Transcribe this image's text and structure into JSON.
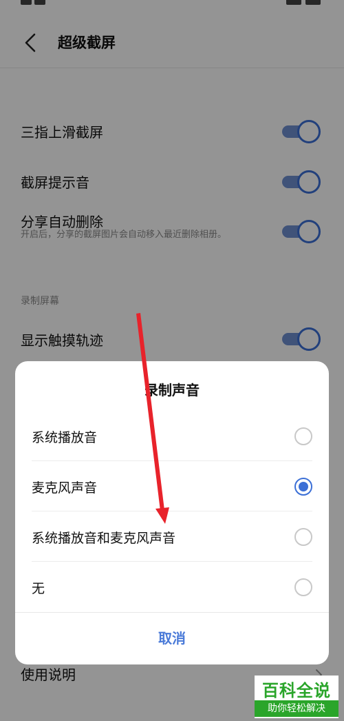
{
  "header": {
    "title": "超级截屏"
  },
  "settings": {
    "items": [
      {
        "label": "三指上滑截屏",
        "enabled": true
      },
      {
        "label": "截屏提示音",
        "enabled": true
      },
      {
        "label": "分享自动删除",
        "subtitle": "开启后，分享的截屏图片会自动移入最近删除相册。",
        "enabled": true
      }
    ],
    "section_record": "录制屏幕",
    "record_items": [
      {
        "label": "显示触摸轨迹",
        "enabled": true
      }
    ],
    "usage": "使用说明"
  },
  "dialog": {
    "title": "录制声音",
    "options": [
      {
        "label": "系统播放音",
        "selected": false
      },
      {
        "label": "麦克风声音",
        "selected": true
      },
      {
        "label": "系统播放音和麦克风声音",
        "selected": false
      },
      {
        "label": "无",
        "selected": false
      }
    ],
    "cancel": "取消"
  },
  "watermark": {
    "title": "百科全说",
    "subtitle": "助你轻松解决"
  },
  "colors": {
    "accent": "#3b6fd6",
    "cancel_text": "#4a7ad8",
    "watermark_green": "#2aa52a"
  }
}
